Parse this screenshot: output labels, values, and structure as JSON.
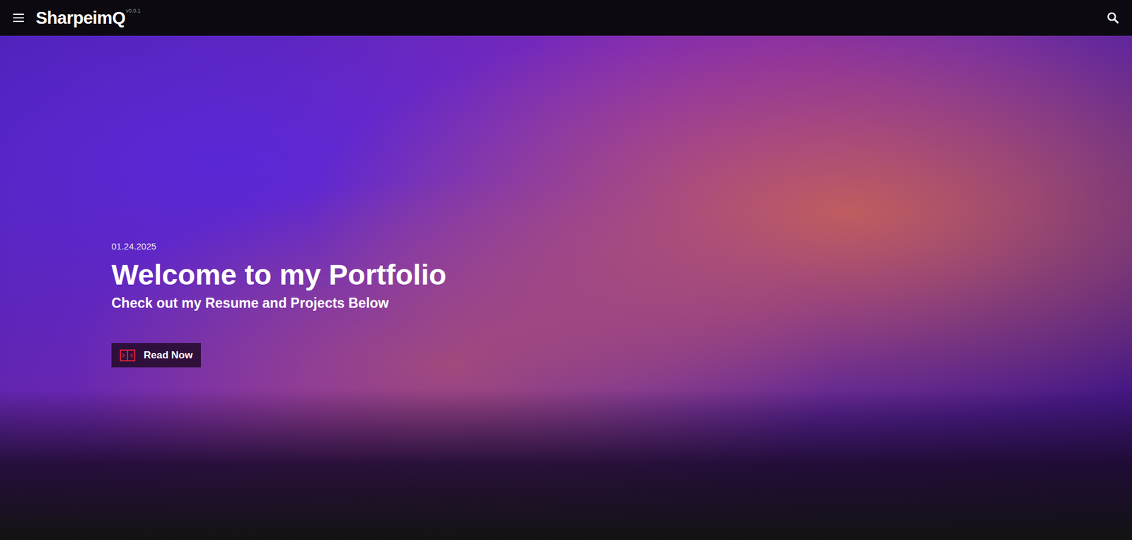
{
  "header": {
    "brand": "SharpeimQ",
    "version": "v0.0.1"
  },
  "hero": {
    "date": "01.24.2025",
    "title": "Welcome to my Portfolio",
    "subtitle": "Check out my Resume and Projects Below",
    "button": "Read Now"
  }
}
